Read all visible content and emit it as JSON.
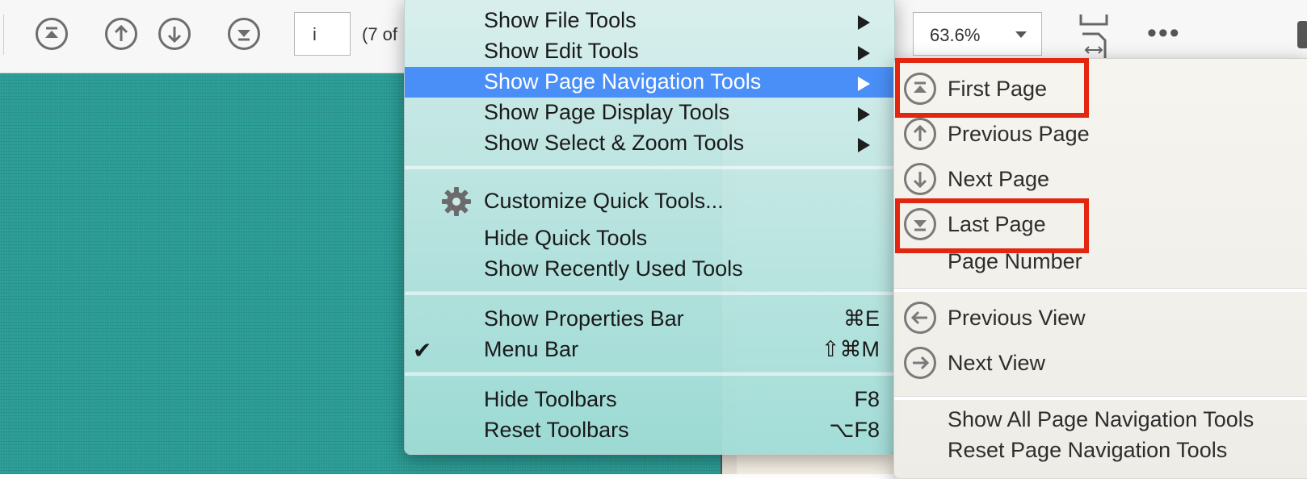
{
  "toolbar": {
    "page_input_value": "i",
    "page_of_text": "(7 of",
    "zoom_value": "63.6%",
    "more_glyph": "•••"
  },
  "main_menu": {
    "items": [
      {
        "label": "Show File Tools",
        "submenu": true
      },
      {
        "label": "Show Edit Tools",
        "submenu": true
      },
      {
        "label": "Show Page Navigation Tools",
        "submenu": true,
        "highlighted": true
      },
      {
        "label": "Show Page Display Tools",
        "submenu": true
      },
      {
        "label": "Show Select & Zoom Tools",
        "submenu": true
      },
      {
        "label": "Customize Quick Tools...",
        "icon": "gear-icon"
      },
      {
        "label": "Hide Quick Tools"
      },
      {
        "label": "Show Recently Used Tools"
      },
      {
        "label": "Show Properties Bar",
        "shortcut": "⌘E"
      },
      {
        "label": "Menu Bar",
        "shortcut": "⇧⌘M",
        "checked": true,
        "check_glyph": "✔"
      },
      {
        "label": "Hide Toolbars",
        "shortcut": "F8"
      },
      {
        "label": "Reset Toolbars",
        "shortcut": "⌥F8"
      }
    ]
  },
  "sub_menu": {
    "items": [
      {
        "label": "First Page",
        "icon": "first-page-icon",
        "highlighted_box": true
      },
      {
        "label": "Previous Page",
        "icon": "previous-page-icon"
      },
      {
        "label": "Next Page",
        "icon": "next-page-icon"
      },
      {
        "label": "Last Page",
        "icon": "last-page-icon",
        "highlighted_box": true
      },
      {
        "label": "Page Number"
      },
      {
        "label": "Previous View",
        "icon": "previous-view-icon"
      },
      {
        "label": "Next View",
        "icon": "next-view-icon"
      },
      {
        "label": "Show All Page Navigation Tools"
      },
      {
        "label": "Reset Page Navigation Tools"
      }
    ]
  },
  "colors": {
    "highlight": "#4a8ff7",
    "annotation_box": "#e2260f",
    "document_teal": "#2a9c95"
  }
}
